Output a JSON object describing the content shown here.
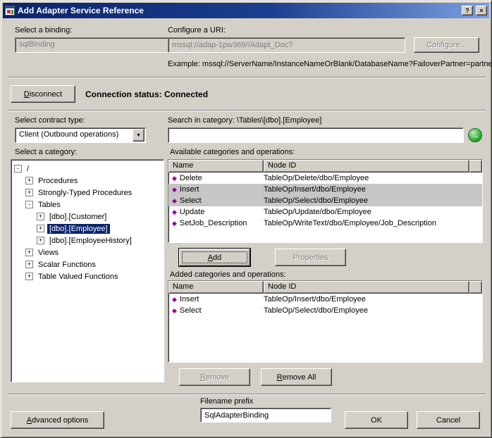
{
  "window": {
    "title": "Add Adapter Service Reference",
    "help_glyph": "?",
    "close_glyph": "×"
  },
  "icons": {
    "go_glyph": "→",
    "operation_glyph": "◆",
    "dropdown_glyph": "▼"
  },
  "binding": {
    "label": "Select a binding:",
    "value": "sqlBinding"
  },
  "uri": {
    "label": "Configure a URI:",
    "value": "mssql://adap-1pw369//Adapt_Doc?",
    "configure_label": "Configure...",
    "example": "Example: mssql://ServerName/InstanceNameOrBlank/DatabaseName?FailoverPartner=partner"
  },
  "connection": {
    "disconnect_label": "Disconnect",
    "status_label": "Connection status:",
    "status_value": "Connected"
  },
  "contract": {
    "label": "Select contract type:",
    "value": "Client (Outbound operations)"
  },
  "search": {
    "label": "Search in category: \\Tables\\[dbo].[Employee]",
    "value": ""
  },
  "category": {
    "label": "Select a category:",
    "tree": [
      {
        "label": "/",
        "depth": 0,
        "expander": "-",
        "selected": false
      },
      {
        "label": "Procedures",
        "depth": 1,
        "expander": "+",
        "selected": false
      },
      {
        "label": "Strongly-Typed Procedures",
        "depth": 1,
        "expander": "+",
        "selected": false
      },
      {
        "label": "Tables",
        "depth": 1,
        "expander": "-",
        "selected": false
      },
      {
        "label": "[dbo].[Customer]",
        "depth": 2,
        "expander": "+",
        "selected": false
      },
      {
        "label": "[dbo].[Employee]",
        "depth": 2,
        "expander": "+",
        "selected": true
      },
      {
        "label": "[dbo].[EmployeeHistory]",
        "depth": 2,
        "expander": "+",
        "selected": false
      },
      {
        "label": "Views",
        "depth": 1,
        "expander": "+",
        "selected": false
      },
      {
        "label": "Scalar Functions",
        "depth": 1,
        "expander": "+",
        "selected": false
      },
      {
        "label": "Table Valued Functions",
        "depth": 1,
        "expander": "+",
        "selected": false
      }
    ]
  },
  "available": {
    "label": "Available categories and operations:",
    "columns": [
      "Name",
      "Node ID"
    ],
    "rows": [
      {
        "name": "Delete",
        "node": "TableOp/Delete/dbo/Employee",
        "selected": false
      },
      {
        "name": "Insert",
        "node": "TableOp/Insert/dbo/Employee",
        "selected": true
      },
      {
        "name": "Select",
        "node": "TableOp/Select/dbo/Employee",
        "selected": true
      },
      {
        "name": "Update",
        "node": "TableOp/Update/dbo/Employee",
        "selected": false
      },
      {
        "name": "SetJob_Description",
        "node": "TableOp/WriteText/dbo/Employee/Job_Description",
        "selected": false
      }
    ]
  },
  "added": {
    "label": "Added categories and operations:",
    "columns": [
      "Name",
      "Node ID"
    ],
    "rows": [
      {
        "name": "Insert",
        "node": "TableOp/Insert/dbo/Employee",
        "selected": false
      },
      {
        "name": "Select",
        "node": "TableOp/Select/dbo/Employee",
        "selected": false
      }
    ]
  },
  "actions": {
    "add": "Add",
    "properties": "Properties",
    "remove": "Remove",
    "remove_all": "Remove All"
  },
  "footer": {
    "advanced": "Advanced options",
    "filename_label": "Filename prefix",
    "filename_value": "SqlAdapterBinding",
    "ok": "OK",
    "cancel": "Cancel"
  }
}
